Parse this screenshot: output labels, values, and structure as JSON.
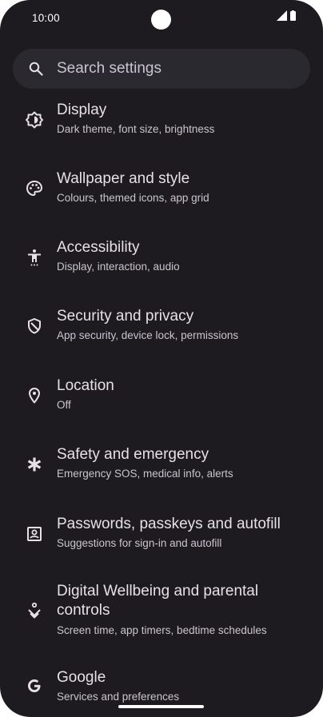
{
  "status_bar": {
    "time": "10:00"
  },
  "search": {
    "placeholder": "Search settings"
  },
  "items": [
    {
      "title": "Display",
      "subtitle": "Dark theme, font size, brightness",
      "icon": "brightness-icon"
    },
    {
      "title": "Wallpaper and style",
      "subtitle": "Colours, themed icons, app grid",
      "icon": "palette-icon"
    },
    {
      "title": "Accessibility",
      "subtitle": "Display, interaction, audio",
      "icon": "accessibility-icon"
    },
    {
      "title": "Security and privacy",
      "subtitle": "App security, device lock, permissions",
      "icon": "shield-icon"
    },
    {
      "title": "Location",
      "subtitle": "Off",
      "icon": "location-pin-icon"
    },
    {
      "title": "Safety and emergency",
      "subtitle": "Emergency SOS, medical info, alerts",
      "icon": "asterisk-icon"
    },
    {
      "title": "Passwords, passkeys and autofill",
      "subtitle": "Suggestions for sign-in and autofill",
      "icon": "account-box-icon"
    },
    {
      "title_line1": "Digital Wellbeing and parental",
      "title_line2": "controls",
      "subtitle": "Screen time, app timers, bedtime schedules",
      "icon": "wellbeing-icon"
    },
    {
      "title": "Google",
      "subtitle": "Services and preferences",
      "icon": "google-g-icon"
    }
  ],
  "colors": {
    "background": "#1d1b20",
    "search_background": "#2b2930",
    "title_text": "#e6e1e5",
    "subtitle_text": "#cac4d0"
  }
}
